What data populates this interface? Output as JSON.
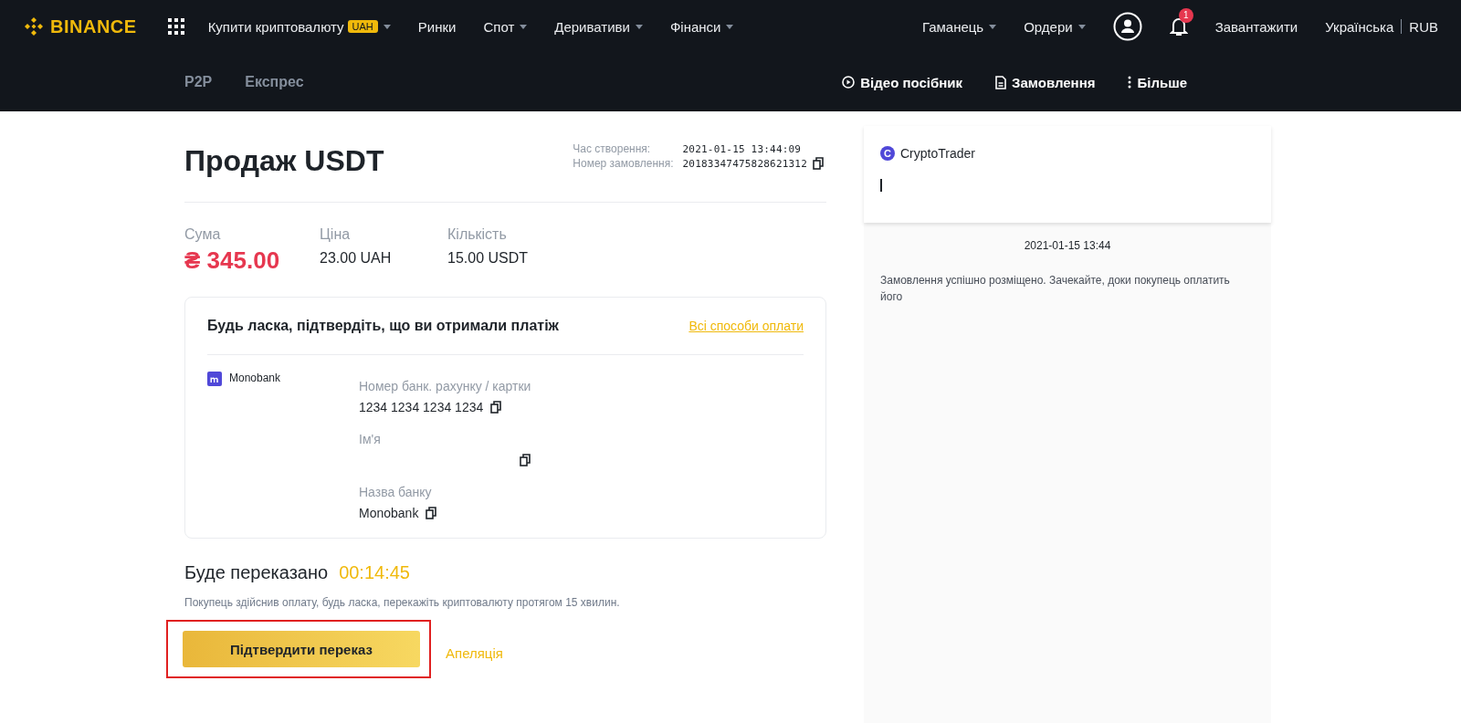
{
  "top_nav": {
    "logo": "BINANCE",
    "left_items": [
      {
        "label": "Купити криптовалюту",
        "badge": "UAH",
        "dropdown": true
      },
      {
        "label": "Ринки",
        "dropdown": false
      },
      {
        "label": "Спот",
        "dropdown": true
      },
      {
        "label": "Деривативи",
        "dropdown": true
      },
      {
        "label": "Фінанси",
        "dropdown": true
      }
    ],
    "right_items": [
      {
        "label": "Гаманець",
        "dropdown": true
      },
      {
        "label": "Ордери",
        "dropdown": true
      }
    ],
    "notification_count": "1",
    "download": "Завантажити",
    "language": "Українська",
    "currency": "RUB"
  },
  "sub_nav": {
    "tabs": [
      {
        "label": "P2P",
        "selected": false
      },
      {
        "label": "Експрес",
        "selected": false
      }
    ],
    "actions": [
      {
        "kind": "video",
        "label": "Відео посібник"
      },
      {
        "kind": "orders",
        "label": "Замовлення"
      },
      {
        "kind": "more",
        "label": "Більше"
      }
    ]
  },
  "order": {
    "title": "Продаж USDT",
    "meta": [
      {
        "label": "Час створення:",
        "value": "2021-01-15 13:44:09",
        "copyable": false
      },
      {
        "label": "Номер замовлення:",
        "value": "20183347475828621312",
        "copyable": true
      }
    ],
    "summary": [
      {
        "label": "Сума",
        "value": "₴ 345.00",
        "kind": "amount"
      },
      {
        "label": "Ціна",
        "value": "23.00 UAH",
        "kind": "plain"
      },
      {
        "label": "Кількість",
        "value": "15.00 USDT",
        "kind": "plain"
      }
    ],
    "payment": {
      "heading": "Будь ласка, підтвердіть, що ви отримали платіж",
      "all_methods_link": "Всі способи оплати",
      "method": "Monobank",
      "fields": [
        {
          "label": "Номер банк. рахунку / картки",
          "value": "1234 1234 1234 1234"
        },
        {
          "label": "Ім'я"
        },
        {
          "label": "Назва банку",
          "value": "Monobank"
        }
      ]
    },
    "transfer_title": "Буде переказано",
    "timer": "00:14:45",
    "notice": "Покупець здійснив оплату, будь ласка, перекажіть криптовалюту протягом 15 хвилин.",
    "confirm_button": "Підтвердити переказ",
    "appeal_link": "Апеляція"
  },
  "chat": {
    "counterparty_initial": "C",
    "counterparty": "CryptoTrader",
    "messages": [
      {
        "time": "2021-01-15 13:44",
        "text": "Замовлення успішно розміщено. Зачекайте, доки покупець оплатить його"
      }
    ]
  }
}
